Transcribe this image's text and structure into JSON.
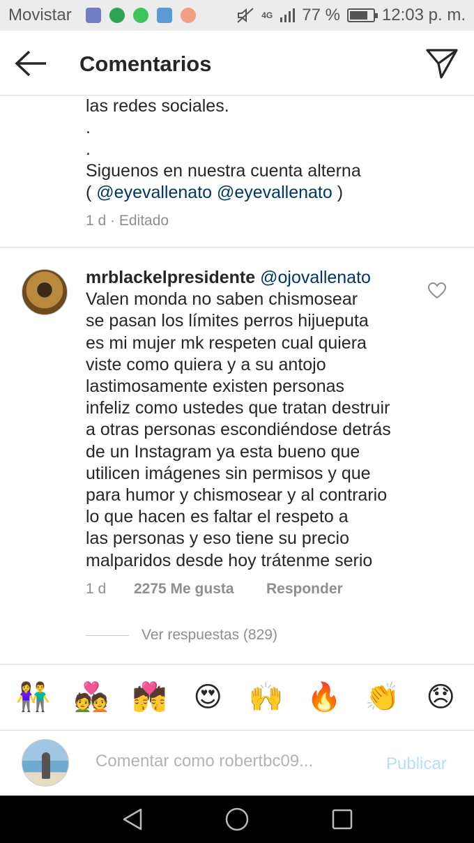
{
  "status_bar": {
    "carrier": "Movistar",
    "network": "4G",
    "battery": "77 %",
    "battery_level": 0.77,
    "time": "12:03 p. m.",
    "icons": [
      "gallery-icon",
      "hangouts-icon",
      "whatsapp-icon",
      "photo-icon",
      "pinterest-icon",
      "mute-icon",
      "signal-icon",
      "battery-icon"
    ]
  },
  "header": {
    "title": "Comentarios",
    "back_icon": "arrow-left-icon",
    "send_icon": "paper-plane-icon"
  },
  "caption": {
    "text_start": "las redes sociales.\n.\n.\nSiguenos en nuestra cuenta alterna\n( ",
    "mention_1": "@eyevallenato",
    "mention_2": "@eyevallenato",
    "text_end": " )",
    "meta": "1 d · Editado"
  },
  "comment": {
    "username": "mrblackelpresidente",
    "mention": "@ojovallenato",
    "text": "Valen monda no saben chismosear\nse pasan los límites perros hijueputa\nes mi mujer mk respeten cual quiera\nviste como quiera y a su antojo\nlastimosamente existen personas\ninfeliz como ustedes que tratan destruir\na otras personas escondiéndose detrás\nde un Instagram ya esta bueno que\nutilicen imágenes sin permisos y que\npara humor y chismosear y al contrario\nlo que hacen es faltar el respeto a\nlas personas y eso tiene su precio\nmalparidos desde hoy trátenme serio",
    "time": "1 d",
    "likes": "2275 Me gusta",
    "reply_label": "Responder",
    "view_replies": "Ver respuestas (829)"
  },
  "emoji_bar": [
    "👫",
    "💑",
    "💏",
    "😍",
    "🙌",
    "🔥",
    "👏",
    "😞"
  ],
  "input": {
    "placeholder": "Comentar como robertbc09...",
    "publish_label": "Publicar"
  },
  "colors": {
    "mention": "#003569",
    "meta": "#8e8e8e",
    "publish_disabled": "#b2dffc"
  }
}
